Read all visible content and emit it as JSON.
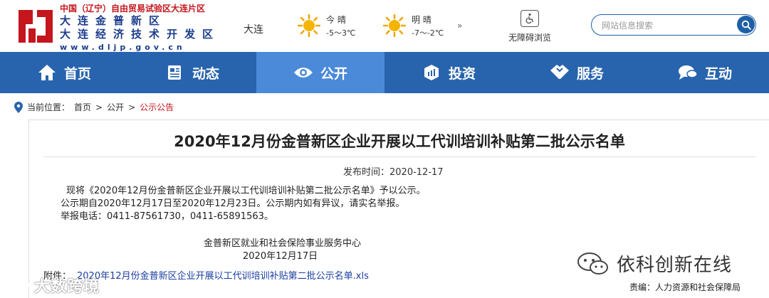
{
  "header": {
    "logo_lines": [
      "中国（辽宁）自由贸易试验区大连片区",
      "大连金普新区",
      "大连经济技术开发区",
      "www.dljp.gov.cn"
    ],
    "city": "大连",
    "weather": [
      {
        "day": "今 晴",
        "temp": "-5～3℃",
        "icon": "sun-icon"
      },
      {
        "day": "明 晴",
        "temp": "-7～-2℃",
        "icon": "sun-icon"
      }
    ],
    "more_weather": "»",
    "accessibility_label": "无障碍浏览",
    "search_placeholder": "网站信息搜索"
  },
  "nav": {
    "items": [
      {
        "label": "首页",
        "icon": "home-icon"
      },
      {
        "label": "动态",
        "icon": "news-icon"
      },
      {
        "label": "公开",
        "icon": "eye-icon",
        "active": true
      },
      {
        "label": "投资",
        "icon": "cube-icon"
      },
      {
        "label": "服务",
        "icon": "handshake-icon"
      },
      {
        "label": "互动",
        "icon": "chat-icon"
      }
    ]
  },
  "breadcrumb": {
    "prefix": "当前位置：",
    "items": [
      "首页",
      "公开",
      "公示公告"
    ],
    "separator": ">"
  },
  "article": {
    "title": "2020年12月份金普新区企业开展以工代训培训补贴第二批公示名单",
    "published": "发布时间：2020-12-17",
    "paragraphs": [
      "现将《2020年12月份金普新区企业开展以工代训培训补贴第二批公示名单》予以公示。",
      "公示期自2020年12月17日至2020年12月23日。公示期内如有异议，请实名举报。",
      "举报电话：0411-87561730，0411-65891563。"
    ],
    "signature_org": "金普新区就业和社会保险事业服务中心",
    "signature_date": "2020年12月17日",
    "attachment_label": "附件：",
    "attachment_file": "2020年12月份金普新区企业开展以工代训培训补贴第二批公示名单.xls"
  },
  "watermarks": {
    "right": "依科创新在线",
    "left": "大数跨境"
  },
  "editor": "责编：人力资源和社会保障局",
  "colors": {
    "nav_bg": "#2864ad",
    "nav_active": "#4a8ad8",
    "logo_red": "#c4161c",
    "logo_blue": "#1c3c8c",
    "link_blue": "#1a3ea1"
  }
}
